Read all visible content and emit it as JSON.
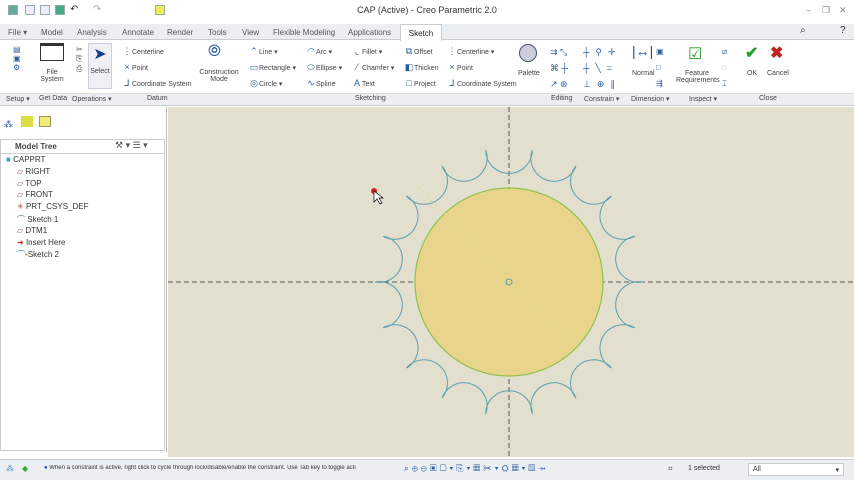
{
  "window": {
    "title": "CAP (Active) - Creo Parametric 2.0"
  },
  "tabs": [
    {
      "label": "File ▾"
    },
    {
      "label": "Model"
    },
    {
      "label": "Analysis"
    },
    {
      "label": "Annotate"
    },
    {
      "label": "Render"
    },
    {
      "label": "Tools"
    },
    {
      "label": "View"
    },
    {
      "label": "Flexible Modeling"
    },
    {
      "label": "Applications"
    },
    {
      "label": "Sketch",
      "active": true
    }
  ],
  "ribbon": {
    "file_system": "File System",
    "select": "Select",
    "datum": {
      "centerline": "Centerline",
      "point": "Point",
      "csys": "Coordinate System"
    },
    "construction": "Construction Mode",
    "sketching": {
      "line": "Line",
      "rectangle": "Rectangle",
      "circle": "Circle",
      "arc": "Arc",
      "ellipse": "Ellipse",
      "spline": "Spline",
      "fillet": "Fillet",
      "chamfer": "Chamfer",
      "text": "Text",
      "offset": "Offset",
      "thicken": "Thicken",
      "project": "Project",
      "centerline": "Centerline",
      "point": "Point",
      "csys": "Coordinate System"
    },
    "palette": "Palette",
    "normal": "Normal",
    "feature_requirements": "Feature Requirements",
    "ok": "OK",
    "cancel": "Cancel"
  },
  "groups": {
    "setup": "Setup ▾",
    "get_data": "Get Data",
    "operations": "Operations ▾",
    "datum": "Datum",
    "sketching": "Sketching",
    "editing": "Editing",
    "constrain": "Constrain ▾",
    "dimension": "Dimension ▾",
    "inspect": "Inspect ▾",
    "close": "Close"
  },
  "model_tree": {
    "title": "Model Tree",
    "items": [
      {
        "label": "CAPPRT",
        "icon": "part-icon"
      },
      {
        "label": "RIGHT",
        "icon": "datum-plane-icon"
      },
      {
        "label": "TOP",
        "icon": "datum-plane-icon"
      },
      {
        "label": "FRONT",
        "icon": "datum-plane-icon"
      },
      {
        "label": "PRT_CSYS_DEF",
        "icon": "csys-icon"
      },
      {
        "label": "Sketch 1",
        "icon": "sketch-icon"
      },
      {
        "label": "DTM1",
        "icon": "datum-plane-icon"
      },
      {
        "label": "Insert Here",
        "icon": "insert-arrow-icon"
      },
      {
        "label": "Sketch 2",
        "icon": "sketch-icon"
      }
    ]
  },
  "status": {
    "message": "When a constraint is active, right click to cycle through lock/disable/enable the constraint. Use Tab key to toggle acti",
    "selected": "1 selected",
    "filter": "All"
  },
  "colors": {
    "canvas": "#e2dfcf",
    "fill": "#e9d48c",
    "circle_stroke": "#8fc34a",
    "contour": "#5aa0b0",
    "ok": "#2aa02a",
    "cancel": "#c0201f"
  }
}
